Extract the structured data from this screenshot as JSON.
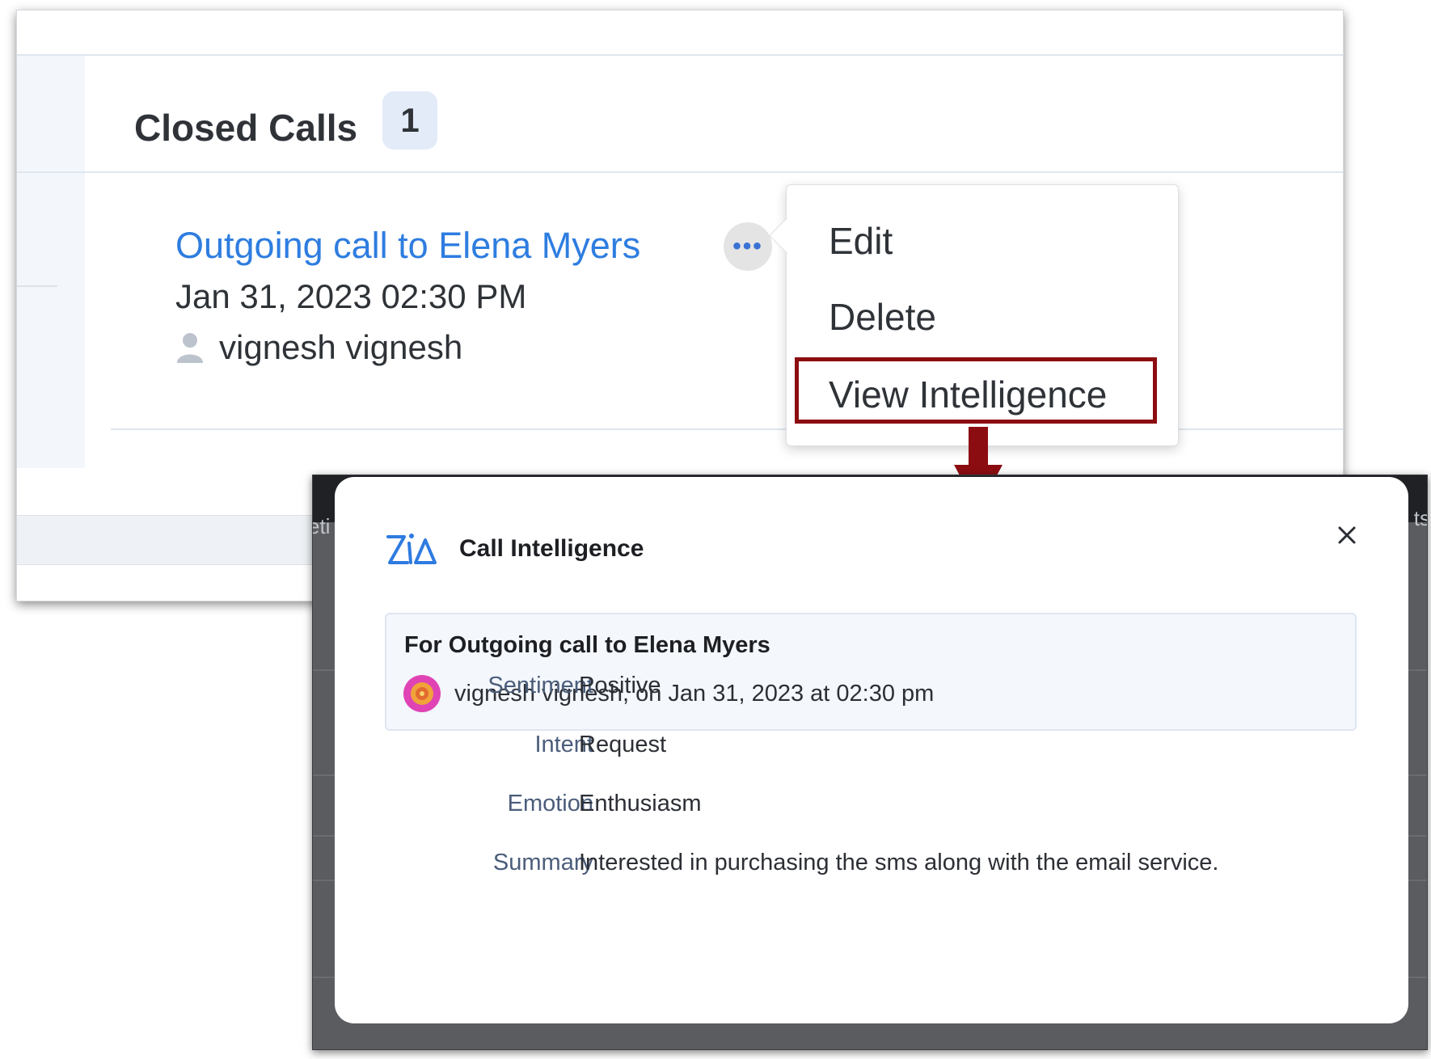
{
  "calls_panel": {
    "section_title": "Closed Calls",
    "count": "1",
    "call": {
      "title": "Outgoing call to Elena Myers",
      "datetime": "Jan 31, 2023 02:30 PM",
      "owner": "vignesh vignesh"
    },
    "more_button": "•••"
  },
  "menu": {
    "items": [
      "Edit",
      "Delete",
      "View Intelligence"
    ]
  },
  "overlay_edges": {
    "left": "eti",
    "right": "ts"
  },
  "dialog": {
    "title": "Call Intelligence",
    "card": {
      "title": "For Outgoing call to Elena Myers",
      "subtitle": "vignesh vignesh, on Jan 31, 2023 at 02:30 pm"
    },
    "rows": [
      {
        "label": "Sentiment",
        "value": "Positive"
      },
      {
        "label": "Intent",
        "value": "Request"
      },
      {
        "label": "Emotion",
        "value": "Enthusiasm"
      },
      {
        "label": "Summary",
        "value": "Interested in purchasing the sms along with the email service."
      }
    ]
  },
  "colors": {
    "link": "#2e7de0",
    "highlight": "#8c0d11",
    "badge_bg": "#e3ebf8",
    "card_bg": "#f4f7fc"
  },
  "icons": [
    "user-icon",
    "more-options-icon",
    "zia-logo-icon",
    "close-icon",
    "avatar-icon",
    "callout-arrow-icon"
  ]
}
